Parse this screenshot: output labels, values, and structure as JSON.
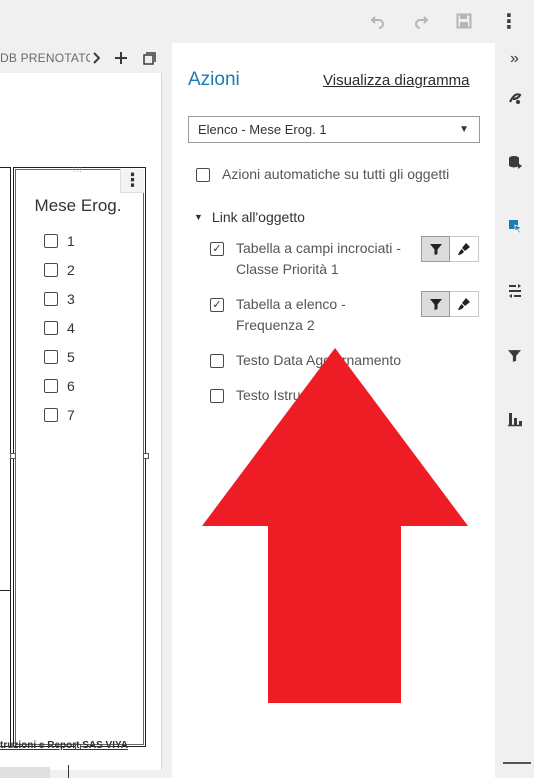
{
  "toolbar": {
    "undo_icon": "undo-icon",
    "redo_icon": "redo-icon",
    "save_icon": "save-icon",
    "more_glyph": "⋮"
  },
  "report": {
    "tab_label": "DB PRENOTATO",
    "list_title": "Mese Erog.",
    "list_items": [
      "1",
      "2",
      "3",
      "4",
      "5",
      "6",
      "7"
    ],
    "more_glyph": "⋮",
    "footer_link": "truzioni e Report SAS VIYA"
  },
  "actions": {
    "title": "Azioni",
    "diagram_link": "Visualizza diagramma",
    "selected_object": "Elenco - Mese Erog. 1",
    "auto_actions_label": "Azioni automatiche su tutti gli oggetti",
    "auto_actions_checked": false,
    "section_title": "Link all'oggetto",
    "links": [
      {
        "label_line1": "Tabella a campi incrociati -",
        "label_line2": "Classe Priorità 1",
        "checked": true,
        "check_glyph": "✓"
      },
      {
        "label_line1": "Tabella a elenco -",
        "label_line2": "Frequenza 2",
        "checked": true,
        "check_glyph": "✓"
      },
      {
        "label_line1": "Testo Data Aggiornamento",
        "checked": false
      },
      {
        "label_line1": "Testo Istruzioni",
        "checked": false
      }
    ]
  },
  "rail": {
    "expand_glyph": "»",
    "items": [
      "options-icon",
      "data-icon",
      "actions-icon",
      "rules-icon",
      "filters-icon",
      "roles-icon"
    ],
    "active_item": "actions-icon"
  },
  "colors": {
    "accent": "#1c7ab4",
    "arrow": "#ee1c25",
    "pane_bg": "#ffffff",
    "chrome_bg": "#f0f0f0"
  }
}
